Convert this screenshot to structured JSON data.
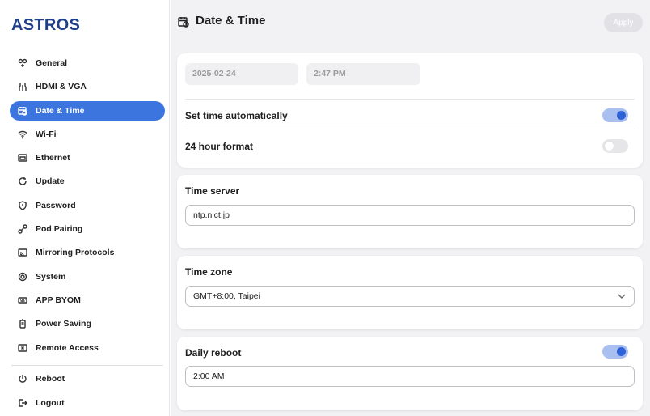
{
  "app": {
    "logo": "ASTROS"
  },
  "sidebar": {
    "items": [
      {
        "label": "General",
        "icon": "general-icon"
      },
      {
        "label": "HDMI & VGA",
        "icon": "hdmi-icon"
      },
      {
        "label": "Date & Time",
        "icon": "calendar-clock-icon",
        "active": true
      },
      {
        "label": "Wi-Fi",
        "icon": "wifi-icon"
      },
      {
        "label": "Ethernet",
        "icon": "ethernet-icon"
      },
      {
        "label": "Update",
        "icon": "update-icon"
      },
      {
        "label": "Password",
        "icon": "shield-icon"
      },
      {
        "label": "Pod Pairing",
        "icon": "pairing-icon"
      },
      {
        "label": "Mirroring Protocols",
        "icon": "cast-icon"
      },
      {
        "label": "System",
        "icon": "system-icon"
      },
      {
        "label": "APP BYOM",
        "icon": "keyboard-icon"
      },
      {
        "label": "Power Saving",
        "icon": "battery-icon"
      },
      {
        "label": "Remote Access",
        "icon": "remote-icon"
      }
    ],
    "bottom": [
      {
        "label": "Reboot",
        "icon": "power-icon"
      },
      {
        "label": "Logout",
        "icon": "logout-icon"
      }
    ]
  },
  "header": {
    "title": "Date & Time",
    "apply_label": "Apply"
  },
  "datetime": {
    "date_value": "2025-02-24",
    "time_value": "2:47 PM",
    "auto_label": "Set time automatically",
    "auto_on": true,
    "h24_label": "24 hour format",
    "h24_on": false
  },
  "time_server": {
    "label": "Time server",
    "value": "ntp.nict.jp"
  },
  "time_zone": {
    "label": "Time zone",
    "value": "GMT+8:00, Taipei"
  },
  "daily_reboot": {
    "label": "Daily reboot",
    "on": true,
    "value": "2:00 AM"
  },
  "colors": {
    "accent": "#3c75dd",
    "toggle_on_track": "#a9bff0",
    "toggle_on_knob": "#2e62d6",
    "logo": "#1f3f8a"
  }
}
